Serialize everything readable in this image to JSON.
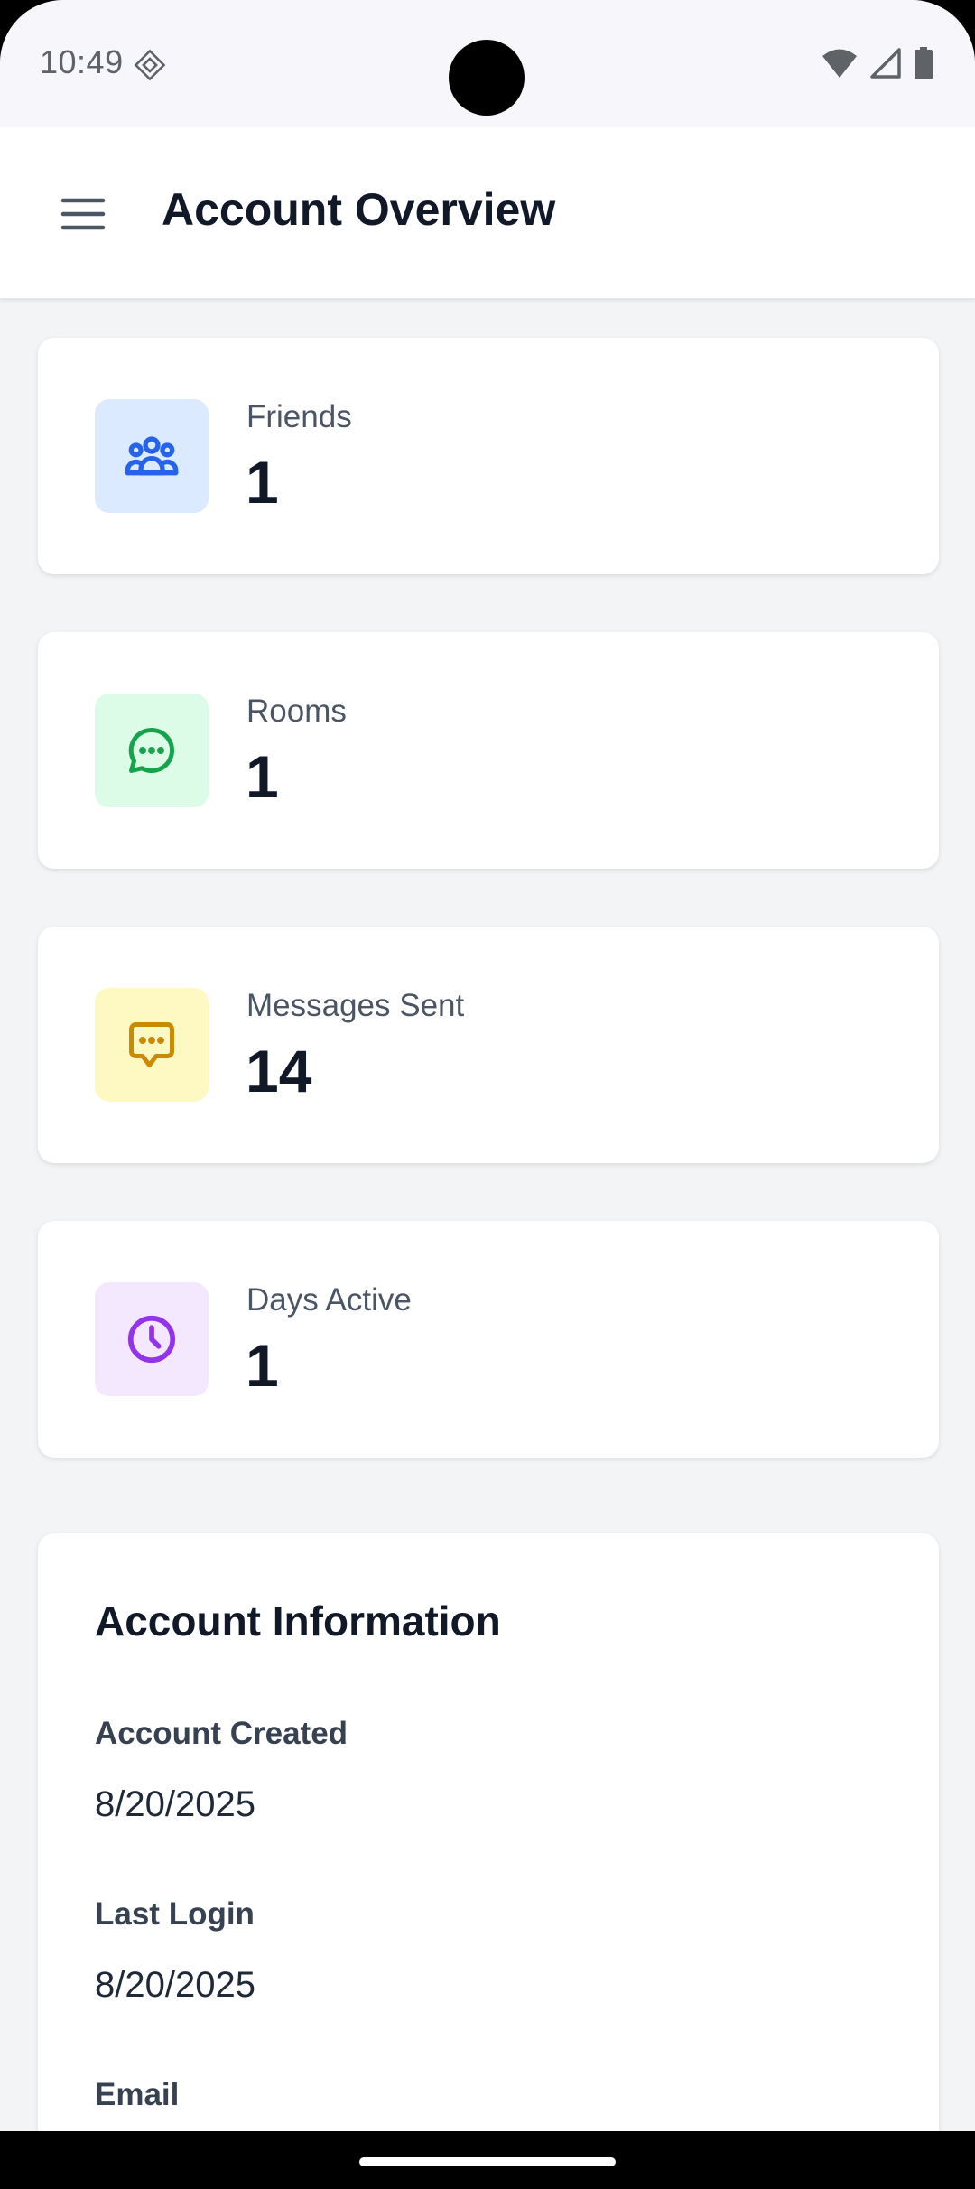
{
  "status_bar": {
    "time": "10:49"
  },
  "header": {
    "title": "Account Overview",
    "menu_icon": "hamburger-menu-icon"
  },
  "stats": [
    {
      "label": "Friends",
      "value": "1",
      "icon": "users-icon",
      "icon_color": "#2563eb",
      "icon_bg": "#dbeafe"
    },
    {
      "label": "Rooms",
      "value": "1",
      "icon": "chat-bubble-icon",
      "icon_color": "#16a34a",
      "icon_bg": "#dcfce7"
    },
    {
      "label": "Messages Sent",
      "value": "14",
      "icon": "message-square-icon",
      "icon_color": "#ca8a04",
      "icon_bg": "#fef9c3"
    },
    {
      "label": "Days Active",
      "value": "1",
      "icon": "clock-icon",
      "icon_color": "#9333ea",
      "icon_bg": "#f3e8ff"
    }
  ],
  "account_info": {
    "title": "Account Information",
    "fields": [
      {
        "label": "Account Created",
        "value": "8/20/2025"
      },
      {
        "label": "Last Login",
        "value": "8/20/2025"
      },
      {
        "label": "Email",
        "value": ""
      }
    ]
  }
}
